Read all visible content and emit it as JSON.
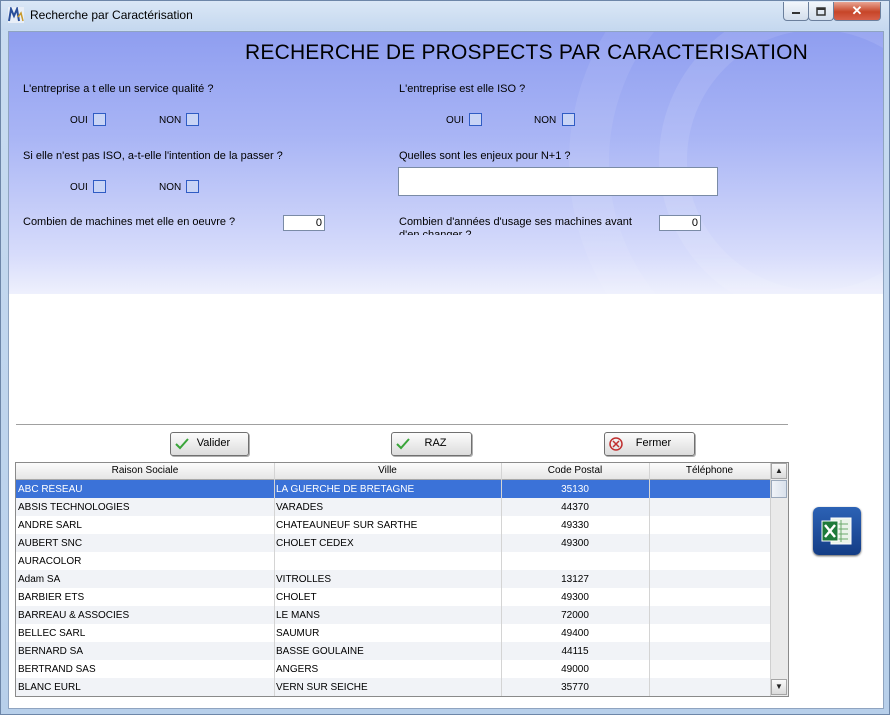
{
  "window": {
    "title": "Recherche par Caractérisation",
    "close_glyph": "✕",
    "app_icon": "app-logo-icon"
  },
  "form": {
    "heading": "RECHERCHE DE PROSPECTS PAR CARACTERISATION",
    "q_service_qualite": "L'entreprise a t elle un service qualité ?",
    "q_iso": "L'entreprise est elle ISO ?",
    "q_intention": "Si elle n'est pas ISO, a-t-elle l'intention de la passer ?",
    "q_enjeux": "Quelles sont les enjeux pour N+1 ?",
    "q_machines": "Combien de machines met elle en oeuvre ?",
    "q_annees": "Combien d'années d'usage ses machines avant d'en changer ?",
    "oui": "OUI",
    "non": "NON",
    "machines_value": "0",
    "annees_value": "0",
    "enjeux_value": ""
  },
  "buttons": {
    "valider": "Valider",
    "raz": "RAZ",
    "fermer": "Fermer"
  },
  "table": {
    "columns": [
      "Raison Sociale",
      "Ville",
      "Code Postal",
      "Téléphone"
    ],
    "rows": [
      [
        "ABC RÉSEAU",
        "LA GUERCHE DE BRETAGNE",
        "35130",
        ""
      ],
      [
        "ABSIS TECHNOLOGIES",
        "VARADES",
        "44370",
        ""
      ],
      [
        "ANDRÉ SARL",
        "CHATEAUNEUF SUR SARTHE",
        "49330",
        ""
      ],
      [
        "AUBERT SNC",
        "CHOLET CEDEX",
        "49300",
        ""
      ],
      [
        "AURACOLOR",
        "",
        "",
        ""
      ],
      [
        "Adam SA",
        "VITROLLES",
        "13127",
        ""
      ],
      [
        "BARBIER ETS",
        "CHOLET",
        "49300",
        ""
      ],
      [
        "BARREAU & ASSOCIÉS",
        "LE MANS",
        "72000",
        ""
      ],
      [
        "BELLEC SARL",
        "SAUMUR",
        "49400",
        ""
      ],
      [
        "BERNARD SA",
        "BASSE GOULAINE",
        "44115",
        ""
      ],
      [
        "BERTRAND SAS",
        "ANGERS",
        "49000",
        ""
      ],
      [
        "BLANC EURL",
        "VERN SUR SEICHE",
        "35770",
        ""
      ]
    ],
    "selected_row": 0
  },
  "colors": {
    "selection": "#3b72d8",
    "form_gradient_top": "#8f9ef0",
    "checkbox_border": "#2f5cc4"
  },
  "export_icon": "excel-export-icon"
}
